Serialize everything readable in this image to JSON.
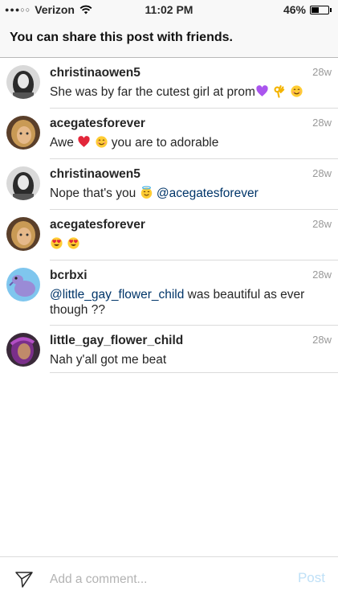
{
  "status_bar": {
    "signal_dots": "●●●○○",
    "carrier": "Verizon",
    "time": "11:02 PM",
    "battery": "46%",
    "battery_level": 0.46
  },
  "banner": {
    "text": "You can share this post with friends."
  },
  "comments": [
    {
      "username": "christinaowen5",
      "time": "28w",
      "segments": [
        {
          "t": "She was by far the cutest girl at prom"
        },
        {
          "e": "purple-heart"
        },
        {
          "t": " "
        },
        {
          "e": "ok-hand"
        },
        {
          "t": " "
        },
        {
          "e": "smile"
        }
      ]
    },
    {
      "username": "acegatesforever",
      "time": "28w",
      "segments": [
        {
          "t": "Awe "
        },
        {
          "e": "red-heart"
        },
        {
          "t": " "
        },
        {
          "e": "smile"
        },
        {
          "t": "  you are to adorable"
        }
      ]
    },
    {
      "username": "christinaowen5",
      "time": "28w",
      "segments": [
        {
          "t": "Nope that's you "
        },
        {
          "e": "halo"
        },
        {
          "t": " "
        },
        {
          "m": "@acegatesforever"
        }
      ]
    },
    {
      "username": "acegatesforever",
      "time": "28w",
      "segments": [
        {
          "e": "heart-eyes"
        },
        {
          "t": " "
        },
        {
          "e": "heart-eyes"
        }
      ]
    },
    {
      "username": "bcrbxi",
      "time": "28w",
      "segments": [
        {
          "m": "@little_gay_flower_child"
        },
        {
          "t": " was beautiful as ever though ??"
        }
      ]
    },
    {
      "username": "little_gay_flower_child",
      "time": "28w",
      "segments": [
        {
          "t": "Nah y'all got me beat"
        }
      ]
    }
  ],
  "composer": {
    "placeholder": "Add a comment...",
    "post_label": "Post"
  },
  "colors": {
    "mention": "#003569",
    "post_disabled": "#bfe0f7",
    "divider": "#dbdbdb"
  }
}
